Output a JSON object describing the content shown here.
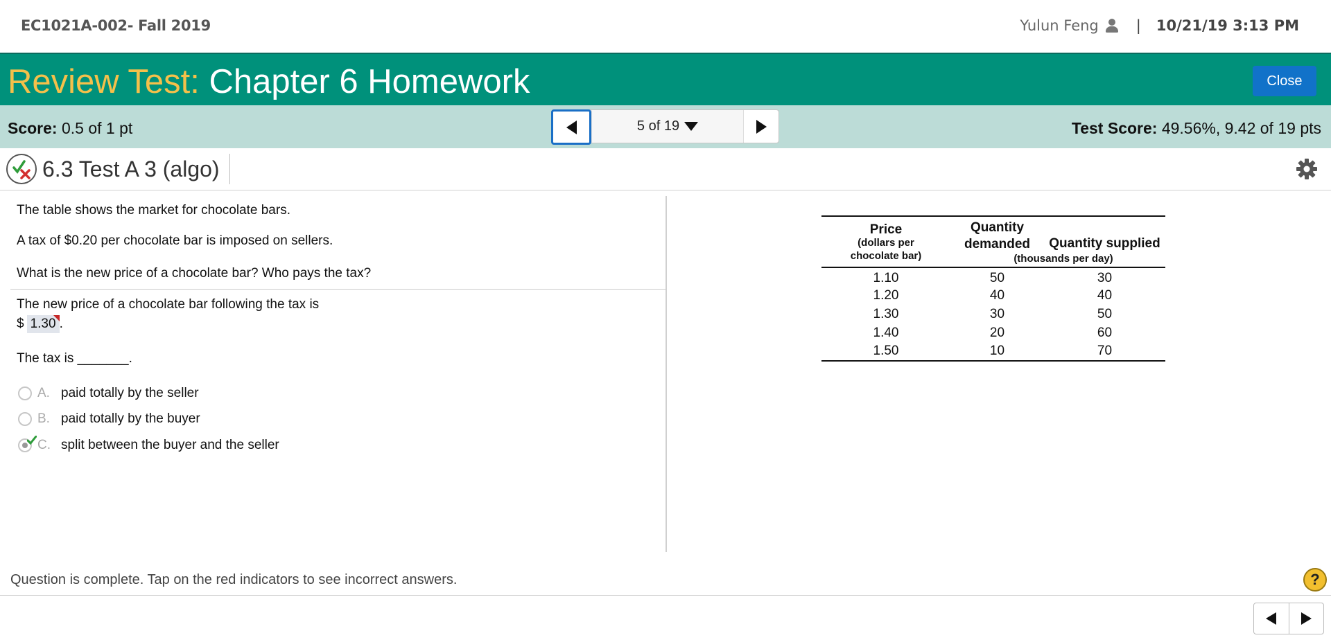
{
  "topbar": {
    "course": "EC1021A-002- Fall 2019",
    "user_name": "Yulun Feng",
    "separator": "|",
    "datetime": "10/21/19 3:13 PM"
  },
  "banner": {
    "prefix": "Review Test:",
    "title": " Chapter 6 Homework",
    "close_label": "Close"
  },
  "scorebar": {
    "score_label": "Score:",
    "score_value": " 0.5 of 1 pt",
    "position": "5 of 19",
    "test_score_label": "Test Score:",
    "test_score_value": " 49.56%, 9.42 of 19 pts"
  },
  "question": {
    "title": "6.3 Test A 3 (algo)",
    "status_icon": "partial-credit-icon",
    "intro": [
      "The table shows the market for chocolate bars.",
      "A tax of $0.20 per chocolate bar is imposed on sellers.",
      "What is the new price of a chocolate bar? Who pays the tax?"
    ],
    "part1_text": "The new price of a chocolate bar following the tax is",
    "currency": "$",
    "part1_answer": "1.30",
    "part1_suffix": ".",
    "part2_text": "The tax is _______.",
    "choices": [
      {
        "letter": "A.",
        "text": "paid totally by the seller",
        "selected": false
      },
      {
        "letter": "B.",
        "text": "paid totally by the buyer",
        "selected": false
      },
      {
        "letter": "C.",
        "text": "split between the buyer and the seller",
        "selected": true
      }
    ]
  },
  "table": {
    "headers": {
      "price": "Price",
      "price_sub": "(dollars per chocolate bar)",
      "qd_top": "Quantity",
      "qd": "demanded",
      "qs": "Quantity supplied",
      "units": "(thousands per day)"
    },
    "rows": [
      [
        "1.10",
        "50",
        "30"
      ],
      [
        "1.20",
        "40",
        "40"
      ],
      [
        "1.30",
        "30",
        "50"
      ],
      [
        "1.40",
        "20",
        "60"
      ],
      [
        "1.50",
        "10",
        "70"
      ]
    ]
  },
  "footer": {
    "status": "Question is complete. Tap on the red indicators to see incorrect answers.",
    "help": "?"
  },
  "colors": {
    "banner": "#00917b",
    "banner_prefix": "#f5c04a",
    "scorebar": "#bcdcd7",
    "close_button": "#1172c9",
    "help_button": "#f2bf2e"
  }
}
